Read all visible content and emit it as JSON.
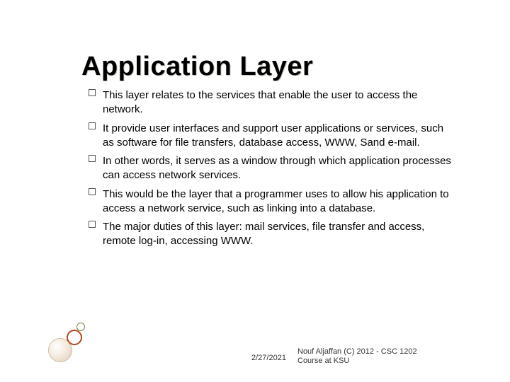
{
  "title": "Application Layer",
  "bullets": [
    "This layer relates to the services that enable the user to access the network.",
    "It provide user interfaces  and support user applications or services, such as software for file transfers, database access, WWW,  Sand e-mail.",
    "In other words, it serves as a window through which application processes can access network services.",
    "This would be the layer that a programmer uses to allow his application to access a network service, such as linking into a database.",
    "The major duties of this layer: mail services, file transfer and access, remote log-in, accessing WWW."
  ],
  "footer": {
    "date": "2/27/2021",
    "credit_line1": "Nouf Aljaffan (C) 2012 - CSC 1202",
    "credit_line2": "Course at KSU"
  }
}
